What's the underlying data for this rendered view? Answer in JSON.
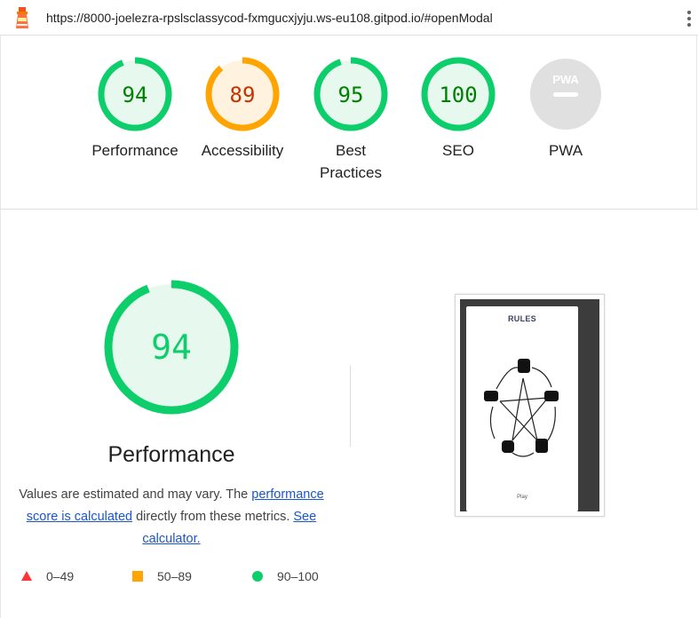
{
  "browser": {
    "url": "https://8000-joelezra-rpslsclassycod-fxmgucxjyju.ws-eu108.gitpod.io/#openModal"
  },
  "colors": {
    "pass": "#0cce6b",
    "pass_text": "#008000",
    "pass_fill": "#e7f9ee",
    "average": "#ffa400",
    "average_text": "#c33300",
    "average_fill": "#fff3e0",
    "fail": "#ff3333",
    "na": "#e0e0e0"
  },
  "categories": [
    {
      "id": "performance",
      "score": "94",
      "label": "Performance",
      "status": "pass"
    },
    {
      "id": "accessibility",
      "score": "89",
      "label": "Accessibility",
      "status": "average"
    },
    {
      "id": "best-practices",
      "score": "95",
      "label": "Best Practices",
      "status": "pass"
    },
    {
      "id": "seo",
      "score": "100",
      "label": "SEO",
      "status": "pass"
    },
    {
      "id": "pwa",
      "score": "",
      "badge": "PWA",
      "label": "PWA",
      "status": "na"
    }
  ],
  "performance_section": {
    "score": "94",
    "title": "Performance",
    "desc_part1": "Values are estimated and may vary. The ",
    "desc_link1": "performance score is calculated",
    "desc_part2": " directly from these metrics. ",
    "desc_link2": "See calculator.",
    "legend": [
      {
        "range": "0–49",
        "shape": "triangle"
      },
      {
        "range": "50–89",
        "shape": "square"
      },
      {
        "range": "90–100",
        "shape": "circle"
      }
    ]
  },
  "final_screenshot": {
    "title": "RULES",
    "button_label": "Play"
  }
}
